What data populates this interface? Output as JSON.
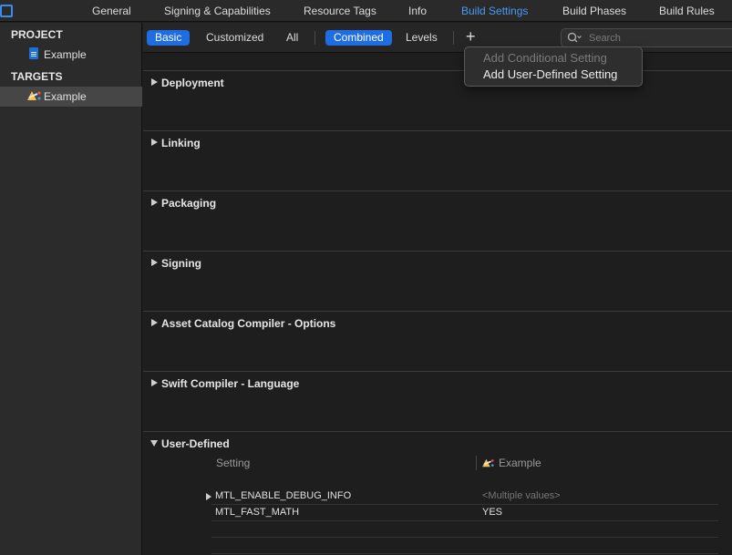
{
  "topbar": {
    "tabs": [
      {
        "label": "General"
      },
      {
        "label": "Signing & Capabilities"
      },
      {
        "label": "Resource Tags"
      },
      {
        "label": "Info"
      },
      {
        "label": "Build Settings"
      },
      {
        "label": "Build Phases"
      },
      {
        "label": "Build Rules"
      }
    ],
    "active_tab": "Build Settings",
    "accent": "#4a9bf5"
  },
  "sidebar": {
    "project_header": "PROJECT",
    "project_item": "Example",
    "targets_header": "TARGETS",
    "target_item": "Example"
  },
  "filterbar": {
    "basic": "Basic",
    "customized": "Customized",
    "all": "All",
    "combined": "Combined",
    "levels": "Levels",
    "add": "+",
    "search_placeholder": "Search",
    "pill_color": "#1f6de2"
  },
  "menu": {
    "conditional": "Add Conditional Setting",
    "user_defined": "Add User-Defined Setting"
  },
  "sections": [
    {
      "title": "Deployment"
    },
    {
      "title": "Linking"
    },
    {
      "title": "Packaging"
    },
    {
      "title": "Signing"
    },
    {
      "title": "Asset Catalog Compiler - Options"
    },
    {
      "title": "Swift Compiler - Language"
    },
    {
      "title": "User-Defined"
    }
  ],
  "user_defined": {
    "col_setting": "Setting",
    "col_target": "Example",
    "rows": [
      {
        "key": "MTL_ENABLE_DEBUG_INFO",
        "value": "<Multiple values>"
      },
      {
        "key": "MTL_FAST_MATH",
        "value": "YES"
      }
    ]
  }
}
